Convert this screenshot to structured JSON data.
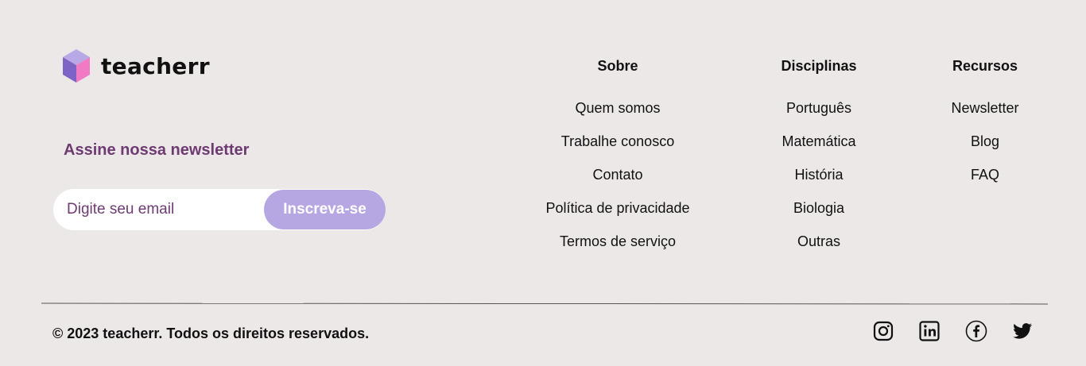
{
  "brand": {
    "name": "teacherr",
    "logo_icon": "cube-logo-icon"
  },
  "newsletter": {
    "title": "Assine nossa newsletter",
    "email_placeholder": "Digite seu email",
    "submit_label": "Inscreva-se"
  },
  "columns": {
    "sobre": {
      "title": "Sobre",
      "items": [
        "Quem somos",
        "Trabalhe conosco",
        "Contato",
        "Política de privacidade",
        "Termos de serviço"
      ]
    },
    "disciplinas": {
      "title": "Disciplinas",
      "items": [
        "Português",
        "Matemática",
        "História",
        "Biologia",
        "Outras"
      ]
    },
    "recursos": {
      "title": "Recursos",
      "items": [
        "Newsletter",
        "Blog",
        "FAQ"
      ]
    }
  },
  "copyright": "© 2023 teacherr. Todos os direitos reservados.",
  "social": [
    "instagram-icon",
    "linkedin-icon",
    "facebook-icon",
    "twitter-icon"
  ],
  "colors": {
    "background": "#ece8e7",
    "accent_purple": "#6d3a72",
    "button_lavender": "#b6a7e3",
    "logo_top": "#b9a8e6",
    "logo_left": "#7e63c6",
    "logo_right": "#f07ac4"
  }
}
